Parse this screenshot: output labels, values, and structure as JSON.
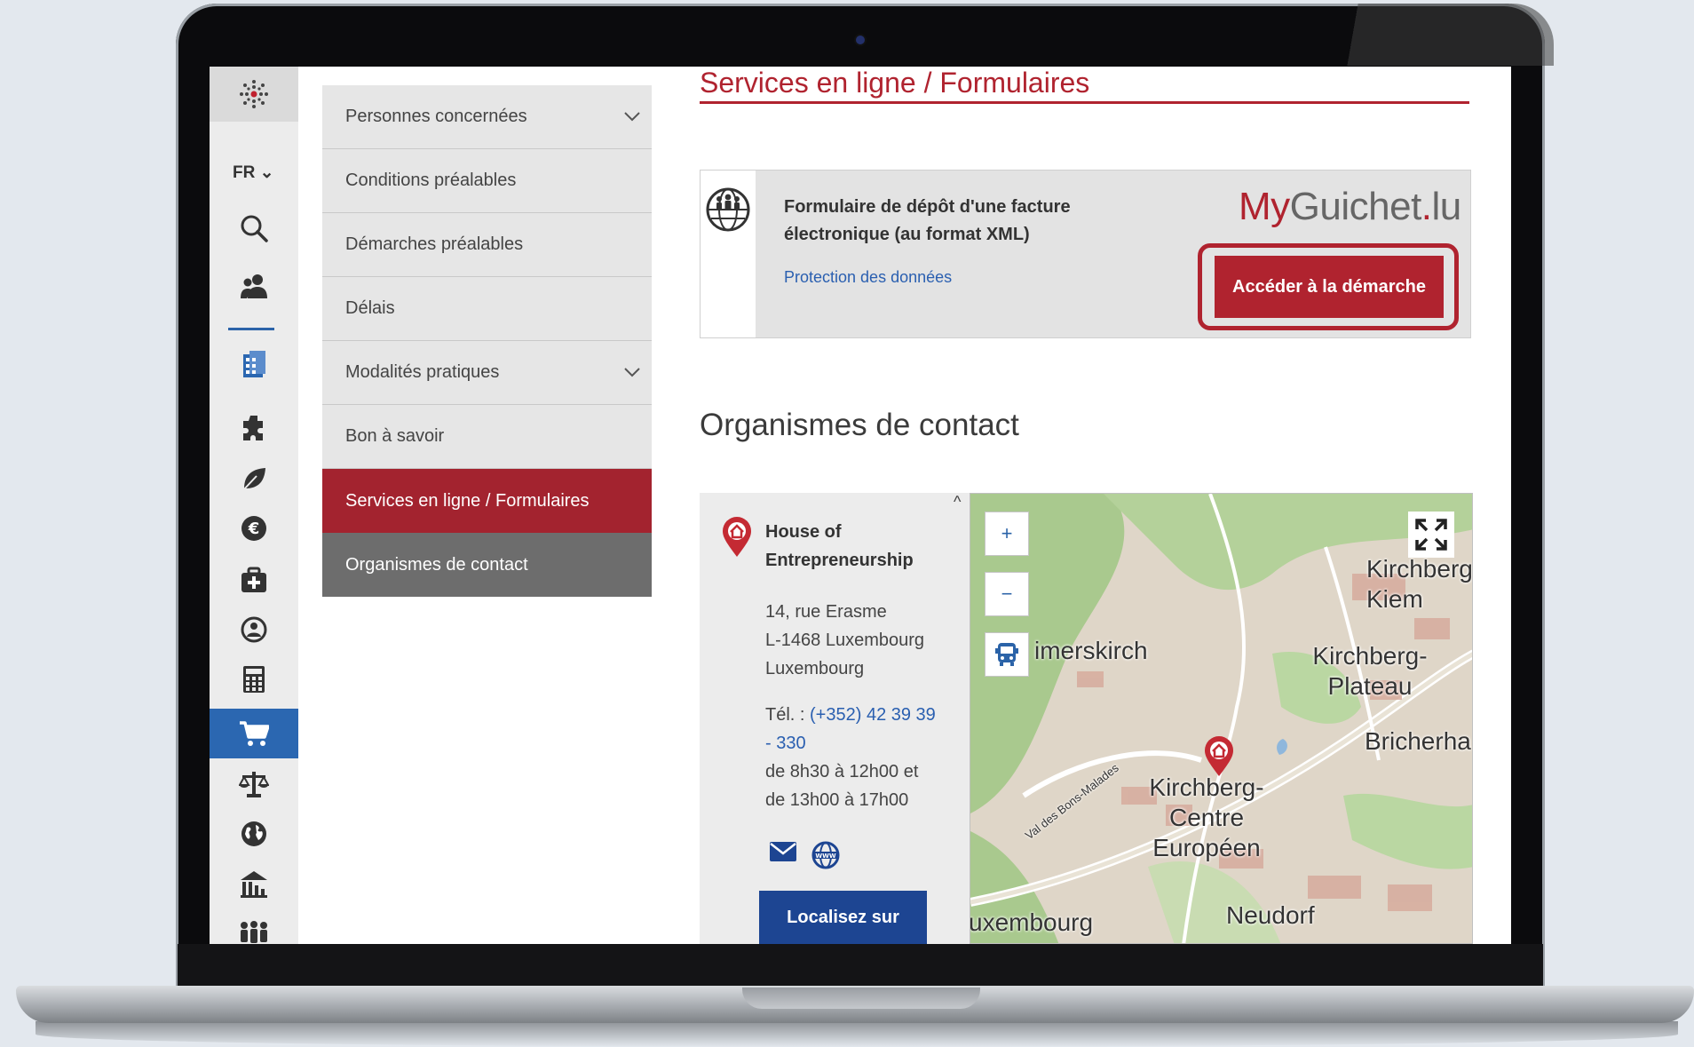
{
  "rail": {
    "lang": "FR",
    "icons": [
      "search-icon",
      "people-icon",
      "building-icon",
      "puzzle-icon",
      "leaf-icon",
      "euro-icon",
      "medical-case-icon",
      "exchange-person-icon",
      "calculator-icon",
      "cart-icon",
      "balance-scale-icon",
      "globe-icon",
      "ruins-icon",
      "group-icon"
    ]
  },
  "menu": {
    "items": [
      {
        "label": "Personnes concernées"
      },
      {
        "label": "Conditions préalables"
      },
      {
        "label": "Démarches préalables"
      },
      {
        "label": "Délais"
      },
      {
        "label": "Modalités pratiques"
      },
      {
        "label": "Bon à savoir"
      },
      {
        "label": "Services en ligne / Formulaires"
      },
      {
        "label": "Organismes de contact"
      }
    ]
  },
  "main": {
    "title": "Services en ligne / Formulaires",
    "card": {
      "title": "Formulaire de dépôt d'une facture électronique (au format XML)",
      "link": "Protection des données",
      "brand_my": "My",
      "brand_mid": "Guichet",
      "brand_dot": ".",
      "brand_tld": "lu",
      "cta": "Accéder à la démarche"
    },
    "section_title": "Organismes de contact",
    "contact": {
      "name": "House of Entrepreneurship",
      "address": [
        "14, rue Erasme",
        "L-1468 Luxembourg",
        "Luxembourg"
      ],
      "tel_label": "Tél. :",
      "tel_value": "(+352) 42 39 39 - 330",
      "hours": "de 8h30 à 12h00 et de 13h00 à 17h00",
      "locate_button": "Localisez sur"
    },
    "map": {
      "zoom_in": "+",
      "zoom_out": "−",
      "labels": {
        "kirchberg_kiem": "Kirchberg Kiem",
        "imerskirch": "imerskirch",
        "plateau": "Kirchberg- Plateau",
        "bricherhaff": "Bricherha",
        "centre": "Kirchberg- Centre Européen",
        "luxembourg": "uxembourg",
        "neudorf": "Neudorf",
        "bons_malades": "Val des Bons-Malades"
      }
    }
  },
  "colors": {
    "accent": "#b0232f",
    "link": "#2a5fb0",
    "rail_active": "#2b67b1"
  }
}
